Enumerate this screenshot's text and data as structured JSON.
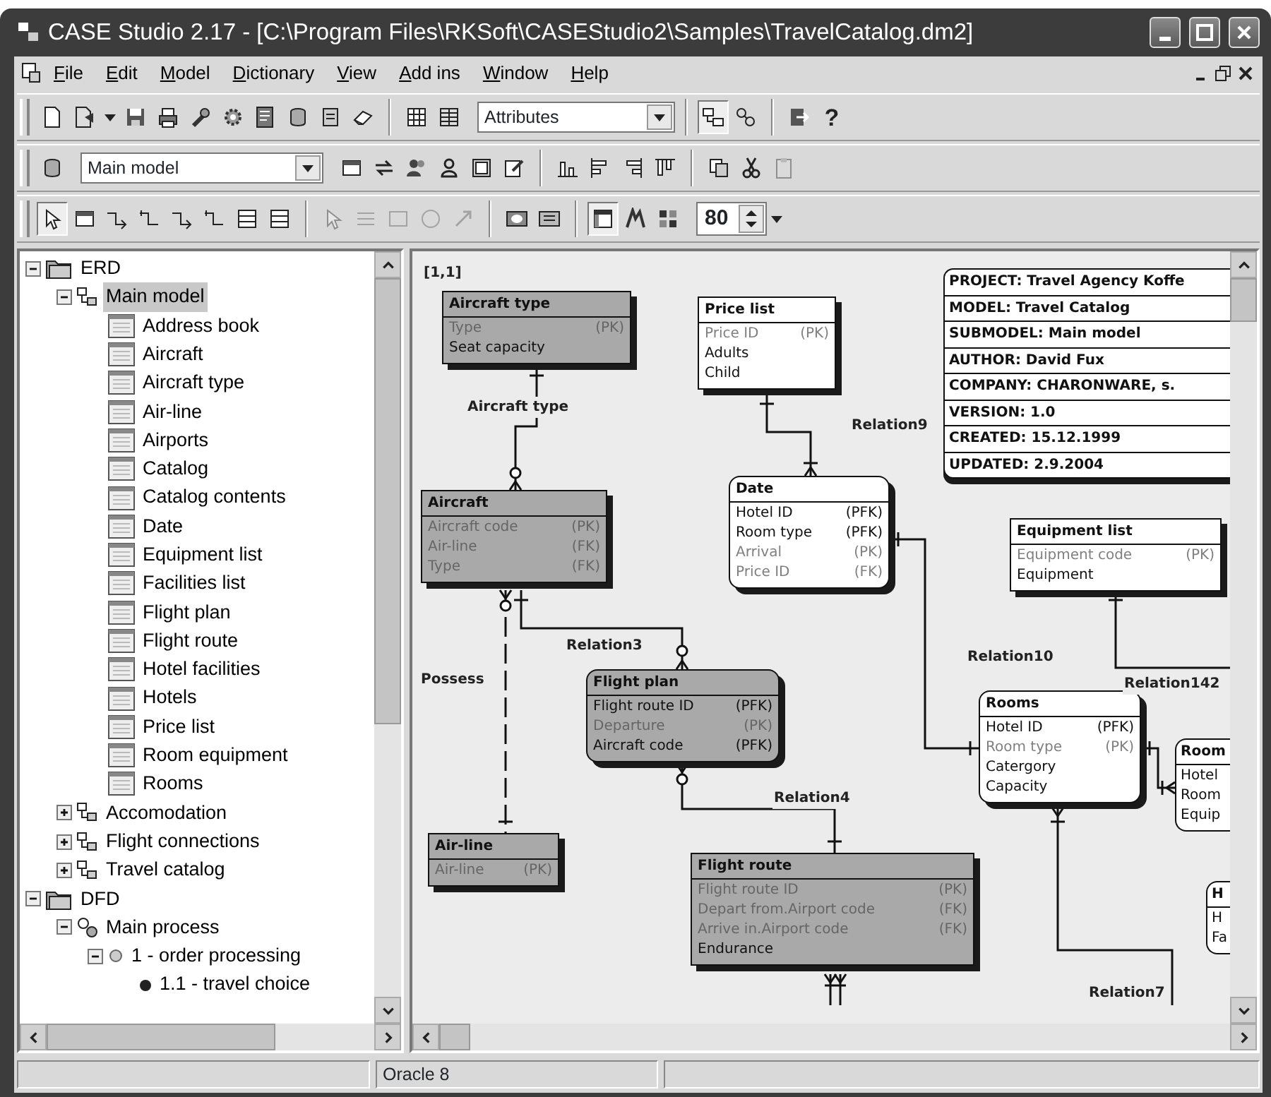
{
  "window": {
    "title": "CASE Studio 2.17 - [C:\\Program Files\\RKSoft\\CASEStudio2\\Samples\\TravelCatalog.dm2]"
  },
  "menu": [
    "File",
    "Edit",
    "Model",
    "Dictionary",
    "View",
    "Add ins",
    "Window",
    "Help"
  ],
  "toolbars": [
    {
      "items": [
        {
          "kind": "button",
          "pressed": false,
          "disabled": false
        },
        {
          "kind": "button",
          "pressed": false,
          "disabled": false
        },
        {
          "kind": "menu_arrow"
        },
        {
          "kind": "button",
          "pressed": false,
          "disabled": false
        },
        {
          "kind": "button",
          "pressed": false,
          "disabled": false
        },
        {
          "kind": "button",
          "pressed": false,
          "disabled": false
        },
        {
          "kind": "button",
          "pressed": false,
          "disabled": false
        },
        {
          "kind": "button",
          "pressed": false,
          "disabled": false
        },
        {
          "kind": "button",
          "pressed": false,
          "disabled": false
        },
        {
          "kind": "button",
          "pressed": false,
          "disabled": false
        },
        {
          "kind": "button",
          "pressed": false,
          "disabled": false
        },
        {
          "kind": "separator"
        },
        {
          "kind": "button",
          "pressed": false,
          "disabled": false
        },
        {
          "kind": "button",
          "pressed": false,
          "disabled": false
        },
        {
          "kind": "combo",
          "value": "Attributes"
        },
        {
          "kind": "separator"
        },
        {
          "kind": "button",
          "pressed": true,
          "disabled": false
        },
        {
          "kind": "button",
          "pressed": false,
          "disabled": false
        },
        {
          "kind": "separator"
        },
        {
          "kind": "button",
          "pressed": false,
          "disabled": false
        },
        {
          "kind": "text_button",
          "label": "?"
        }
      ]
    },
    {
      "items": [
        {
          "kind": "button",
          "pressed": false,
          "disabled": false
        },
        {
          "kind": "combo",
          "value": "Main model"
        },
        {
          "kind": "button",
          "pressed": false,
          "disabled": false
        },
        {
          "kind": "button",
          "pressed": false,
          "disabled": false
        },
        {
          "kind": "button",
          "pressed": false,
          "disabled": false
        },
        {
          "kind": "button",
          "pressed": false,
          "disabled": false
        },
        {
          "kind": "button",
          "pressed": false,
          "disabled": false
        },
        {
          "kind": "button",
          "pressed": false,
          "disabled": false
        },
        {
          "kind": "separator"
        },
        {
          "kind": "button",
          "pressed": false,
          "disabled": false
        },
        {
          "kind": "button",
          "pressed": false,
          "disabled": false
        },
        {
          "kind": "button",
          "pressed": false,
          "disabled": false
        },
        {
          "kind": "button",
          "pressed": false,
          "disabled": false
        },
        {
          "kind": "separator"
        },
        {
          "kind": "button",
          "pressed": false,
          "disabled": false
        },
        {
          "kind": "button",
          "pressed": false,
          "disabled": false
        },
        {
          "kind": "button",
          "pressed": false,
          "disabled": true
        }
      ]
    },
    {
      "items": [
        {
          "kind": "button",
          "pressed": true,
          "disabled": false
        },
        {
          "kind": "button",
          "pressed": false,
          "disabled": false
        },
        {
          "kind": "button",
          "pressed": false,
          "disabled": false
        },
        {
          "kind": "button",
          "pressed": false,
          "disabled": false
        },
        {
          "kind": "button",
          "pressed": false,
          "disabled": false
        },
        {
          "kind": "button",
          "pressed": false,
          "disabled": false
        },
        {
          "kind": "button",
          "pressed": false,
          "disabled": false
        },
        {
          "kind": "button",
          "pressed": false,
          "disabled": false
        },
        {
          "kind": "separator"
        },
        {
          "kind": "button",
          "pressed": false,
          "disabled": true
        },
        {
          "kind": "button",
          "pressed": false,
          "disabled": true
        },
        {
          "kind": "button",
          "pressed": false,
          "disabled": true
        },
        {
          "kind": "button",
          "pressed": false,
          "disabled": true
        },
        {
          "kind": "button",
          "pressed": false,
          "disabled": true
        },
        {
          "kind": "separator"
        },
        {
          "kind": "button",
          "pressed": false,
          "disabled": false
        },
        {
          "kind": "button",
          "pressed": false,
          "disabled": false
        },
        {
          "kind": "separator"
        },
        {
          "kind": "button",
          "pressed": true,
          "disabled": false
        },
        {
          "kind": "button",
          "pressed": false,
          "disabled": false
        },
        {
          "kind": "button",
          "pressed": false,
          "disabled": false
        },
        {
          "kind": "spin",
          "value": "80"
        },
        {
          "kind": "menu_arrow"
        }
      ]
    }
  ],
  "tree": [
    {
      "label": "ERD",
      "kind": "diagram",
      "expanded": true,
      "selected": false,
      "children": [
        {
          "label": "Main model",
          "kind": "model",
          "expanded": true,
          "selected": true,
          "children": [
            {
              "label": "Address book",
              "kind": "entity",
              "selected": false
            },
            {
              "label": "Aircraft",
              "kind": "entity",
              "selected": false
            },
            {
              "label": "Aircraft type",
              "kind": "entity",
              "selected": false
            },
            {
              "label": "Air-line",
              "kind": "entity",
              "selected": false
            },
            {
              "label": "Airports",
              "kind": "entity",
              "selected": false
            },
            {
              "label": "Catalog",
              "kind": "entity",
              "selected": false
            },
            {
              "label": "Catalog contents",
              "kind": "entity",
              "selected": false
            },
            {
              "label": "Date",
              "kind": "entity",
              "selected": false
            },
            {
              "label": "Equipment list",
              "kind": "entity",
              "selected": false
            },
            {
              "label": "Facilities list",
              "kind": "entity",
              "selected": false
            },
            {
              "label": "Flight plan",
              "kind": "entity",
              "selected": false
            },
            {
              "label": "Flight route",
              "kind": "entity",
              "selected": false
            },
            {
              "label": "Hotel facilities",
              "kind": "entity",
              "selected": false
            },
            {
              "label": "Hotels",
              "kind": "entity",
              "selected": false
            },
            {
              "label": "Price list",
              "kind": "entity",
              "selected": false
            },
            {
              "label": "Room equipment",
              "kind": "entity",
              "selected": false
            },
            {
              "label": "Rooms",
              "kind": "entity",
              "selected": false
            }
          ]
        },
        {
          "label": "Accomodation",
          "kind": "model",
          "expanded": false,
          "selected": false
        },
        {
          "label": "Flight connections",
          "kind": "model",
          "expanded": false,
          "selected": false
        },
        {
          "label": "Travel catalog",
          "kind": "model",
          "expanded": false,
          "selected": false
        }
      ]
    },
    {
      "label": "DFD",
      "kind": "diagram",
      "expanded": true,
      "selected": false,
      "children": [
        {
          "label": "Main process",
          "kind": "process",
          "expanded": true,
          "selected": false,
          "children": [
            {
              "label": "1 - order processing",
              "kind": "subprocess",
              "expanded": true,
              "selected": false,
              "children": [
                {
                  "label": "1.1 - travel choice",
                  "kind": "leaf",
                  "selected": false
                }
              ]
            }
          ]
        }
      ]
    }
  ],
  "canvas": {
    "coordinates": "[1,1]",
    "info_box": [
      "PROJECT: Travel Agency Koffe",
      "MODEL: Travel Catalog",
      "SUBMODEL: Main model",
      "AUTHOR: David Fux",
      "COMPANY: CHARONWARE, s.",
      "VERSION: 1.0",
      "CREATED: 15.12.1999",
      "UPDATED: 2.9.2004"
    ],
    "entities": [
      {
        "name": "Aircraft type",
        "shaded": true,
        "rounded": false,
        "attributes": [
          {
            "name": "Type",
            "key": "(PK)",
            "muted": true
          },
          {
            "name": "Seat capacity",
            "muted": false
          }
        ]
      },
      {
        "name": "Price list",
        "shaded": false,
        "rounded": false,
        "attributes": [
          {
            "name": "Price ID",
            "key": "(PK)",
            "muted": true
          },
          {
            "name": "Adults",
            "muted": false
          },
          {
            "name": "Child",
            "muted": false
          }
        ]
      },
      {
        "name": "Aircraft",
        "shaded": true,
        "rounded": false,
        "attributes": [
          {
            "name": "Aircraft code",
            "key": "(PK)",
            "muted": true
          },
          {
            "name": "Air-line",
            "key": "(FK)",
            "muted": true
          },
          {
            "name": "Type",
            "key": "(FK)",
            "muted": true
          }
        ]
      },
      {
        "name": "Date",
        "shaded": false,
        "rounded": true,
        "attributes": [
          {
            "name": "Hotel ID",
            "key": "(PFK)",
            "muted": false
          },
          {
            "name": "Room type",
            "key": "(PFK)",
            "muted": false
          },
          {
            "name": "Arrival",
            "key": "(PK)",
            "muted": true
          },
          {
            "name": "Price ID",
            "key": "(FK)",
            "muted": true
          }
        ]
      },
      {
        "name": "Equipment list",
        "shaded": false,
        "rounded": false,
        "attributes": [
          {
            "name": "Equipment code",
            "key": "(PK)",
            "muted": true
          },
          {
            "name": "Equipment",
            "muted": false
          }
        ]
      },
      {
        "name": "Flight plan",
        "shaded": true,
        "rounded": true,
        "attributes": [
          {
            "name": "Flight route ID",
            "key": "(PFK)",
            "muted": false
          },
          {
            "name": "Departure",
            "key": "(PK)",
            "muted": true
          },
          {
            "name": "Aircraft code",
            "key": "(PFK)",
            "muted": false
          }
        ]
      },
      {
        "name": "Rooms",
        "shaded": false,
        "rounded": true,
        "attributes": [
          {
            "name": "Hotel ID",
            "key": "(PFK)",
            "muted": false
          },
          {
            "name": "Room type",
            "key": "(PK)",
            "muted": true
          },
          {
            "name": "Catergory",
            "muted": false
          },
          {
            "name": "Capacity",
            "muted": false
          }
        ]
      },
      {
        "name": "Room",
        "shaded": false,
        "rounded": true,
        "attributes": [
          {
            "name": "Hotel",
            "muted": false
          },
          {
            "name": "Room",
            "muted": false
          },
          {
            "name": "Equip",
            "muted": false
          }
        ]
      },
      {
        "name": "Air-line",
        "shaded": true,
        "rounded": false,
        "attributes": [
          {
            "name": "Air-line",
            "key": "(PK)",
            "muted": true
          }
        ]
      },
      {
        "name": "Flight route",
        "shaded": true,
        "rounded": false,
        "attributes": [
          {
            "name": "Flight route ID",
            "key": "(PK)",
            "muted": true
          },
          {
            "name": "Depart from.Airport code",
            "key": "(FK)",
            "muted": true
          },
          {
            "name": "Arrive in.Airport code",
            "key": "(FK)",
            "muted": true
          },
          {
            "name": "Endurance",
            "muted": false
          }
        ]
      },
      {
        "name": "H",
        "shaded": false,
        "rounded": true,
        "attributes": [
          {
            "name": "H",
            "muted": false
          },
          {
            "name": "Fa",
            "muted": false
          }
        ]
      }
    ],
    "relation_labels": [
      "Aircraft type",
      "Relation9",
      "Relation3",
      "Possess",
      "Relation10",
      "Relation142",
      "Relation4",
      "Relation7"
    ]
  },
  "status_bar": {
    "database": "Oracle 8"
  }
}
